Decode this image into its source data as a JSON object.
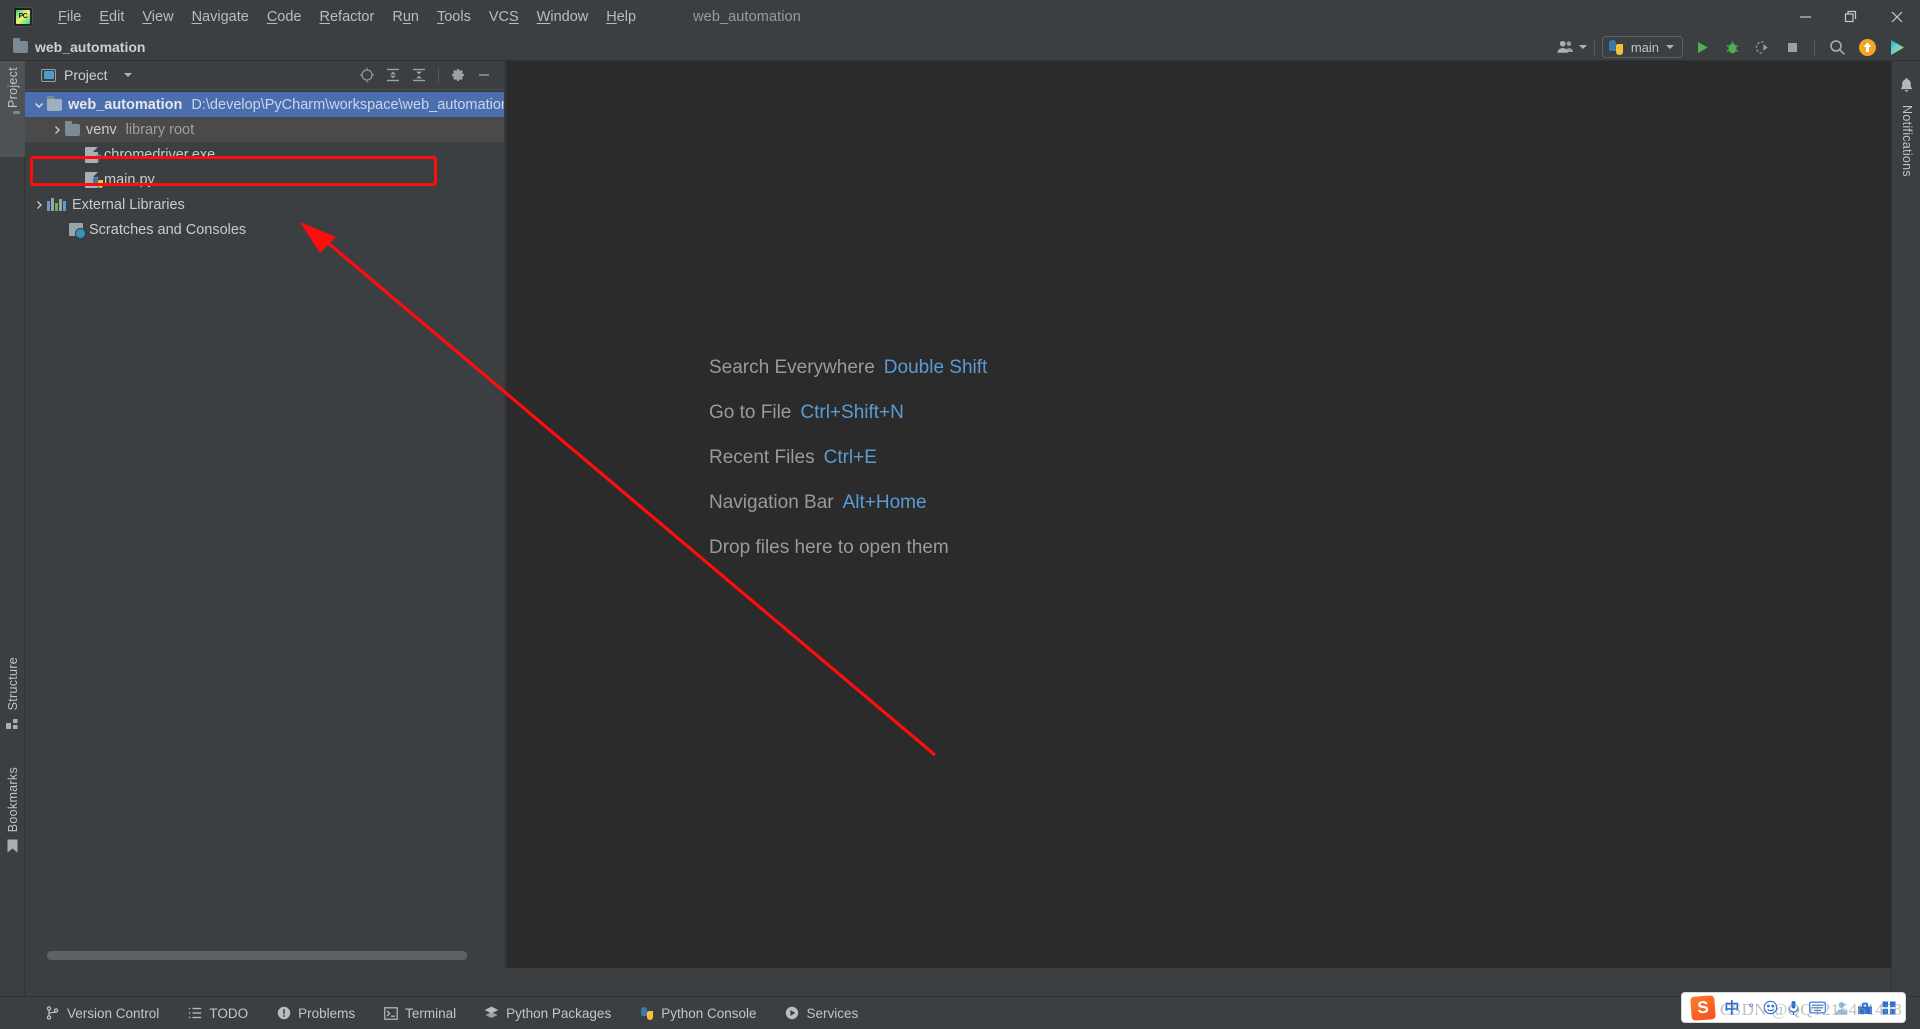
{
  "window": {
    "title": "web_automation",
    "controls": {
      "minimize": "minimize-icon",
      "restore": "restore-icon",
      "close": "close-icon"
    }
  },
  "menubar": {
    "items": [
      {
        "label": "File",
        "mnemonic": "F"
      },
      {
        "label": "Edit",
        "mnemonic": "E"
      },
      {
        "label": "View",
        "mnemonic": "V"
      },
      {
        "label": "Navigate",
        "mnemonic": "N"
      },
      {
        "label": "Code",
        "mnemonic": "C"
      },
      {
        "label": "Refactor",
        "mnemonic": "R"
      },
      {
        "label": "Run",
        "mnemonic": "u"
      },
      {
        "label": "Tools",
        "mnemonic": "T"
      },
      {
        "label": "VCS",
        "mnemonic": "S"
      },
      {
        "label": "Window",
        "mnemonic": "W"
      },
      {
        "label": "Help",
        "mnemonic": "H"
      }
    ]
  },
  "navbar": {
    "project_name": "web_automation",
    "folder_icon": "folder-icon",
    "toolbar": {
      "account_icon": "user-account-icon",
      "run_config": {
        "label": "main",
        "icon": "python-icon"
      },
      "run_icon": "run-icon",
      "debug_icon": "debug-icon",
      "coverage_icon": "run-with-coverage-icon",
      "stop_icon": "stop-icon",
      "search_icon": "search-icon",
      "update_icon": "update-project-icon",
      "ai_icon": "ai-assistant-icon"
    }
  },
  "left_rail": {
    "project_tab": {
      "label": "Project",
      "icon": "project-folder-icon"
    },
    "structure_tab": {
      "label": "Structure",
      "icon": "structure-icon"
    },
    "bookmarks_tab": {
      "label": "Bookmarks",
      "icon": "bookmark-icon"
    },
    "layout_icon": "window-layout-icon"
  },
  "project_panel": {
    "title": "Project",
    "title_icon": "project-view-icon",
    "dropdown_icon": "chevron-down-icon",
    "tools": {
      "locate_icon": "select-opened-file-icon",
      "expand_icon": "expand-all-icon",
      "collapse_icon": "collapse-all-icon",
      "settings_icon": "gear-icon",
      "hide_icon": "hide-panel-icon"
    },
    "tree": [
      {
        "name": "web_automation",
        "sub": "D:\\develop\\PyCharm\\workspace\\web_automation",
        "icon": "folder-icon",
        "depth": 0,
        "state": "expanded",
        "selected": true,
        "bold": true
      },
      {
        "name": "venv",
        "sub": "library root",
        "icon": "folder-icon",
        "depth": 1,
        "state": "collapsed",
        "selected": false,
        "hovered": true,
        "bold": false
      },
      {
        "name": "chromedriver.exe",
        "sub": "",
        "icon": "unknown-file-icon",
        "depth": 2,
        "state": "leaf",
        "selected": false,
        "bold": false,
        "highlighted": true
      },
      {
        "name": "main.py",
        "sub": "",
        "icon": "python-file-icon",
        "depth": 2,
        "state": "leaf",
        "selected": false,
        "bold": false
      },
      {
        "name": "External Libraries",
        "sub": "",
        "icon": "libraries-icon",
        "depth": 0,
        "state": "collapsed",
        "selected": false,
        "bold": false
      },
      {
        "name": "Scratches and Consoles",
        "sub": "",
        "icon": "scratches-icon",
        "depth": 0,
        "state": "leaf",
        "selected": false,
        "bold": false
      }
    ],
    "scrollbar": "horizontal-scrollbar"
  },
  "editor": {
    "hints": [
      {
        "label": "Search Everywhere",
        "shortcut": "Double Shift"
      },
      {
        "label": "Go to File",
        "shortcut": "Ctrl+Shift+N"
      },
      {
        "label": "Recent Files",
        "shortcut": "Ctrl+E"
      },
      {
        "label": "Navigation Bar",
        "shortcut": "Alt+Home"
      }
    ],
    "drop_text": "Drop files here to open them"
  },
  "right_rail": {
    "notifications": {
      "label": "Notifications",
      "icon": "bell-icon"
    }
  },
  "statusbar": {
    "items": [
      {
        "label": "Version Control",
        "icon": "branch-icon"
      },
      {
        "label": "TODO",
        "icon": "todo-list-icon"
      },
      {
        "label": "Problems",
        "icon": "problems-icon"
      },
      {
        "label": "Terminal",
        "icon": "terminal-icon"
      },
      {
        "label": "Python Packages",
        "icon": "packages-icon"
      },
      {
        "label": "Python Console",
        "icon": "python-console-icon"
      },
      {
        "label": "Services",
        "icon": "services-icon"
      }
    ]
  },
  "system_tray": {
    "ime_logo": "sogou-ime-logo",
    "language": "中",
    "mode": "°",
    "icons": [
      "emoji-icon",
      "voice-input-icon",
      "keyboard-icon",
      "user-icon",
      "toolbox-icon",
      "apps-icon"
    ]
  },
  "annotations": {
    "watermark": "CSDN @QQ1215461408",
    "highlight_color": "#ff0d0d",
    "arrow": "red-annotation-arrow"
  },
  "colors": {
    "selection_blue": "#4b6eaf",
    "editor_bg": "#2b2b2b",
    "chrome_bg": "#3c3f41",
    "hint_link": "#5b9bd5"
  }
}
